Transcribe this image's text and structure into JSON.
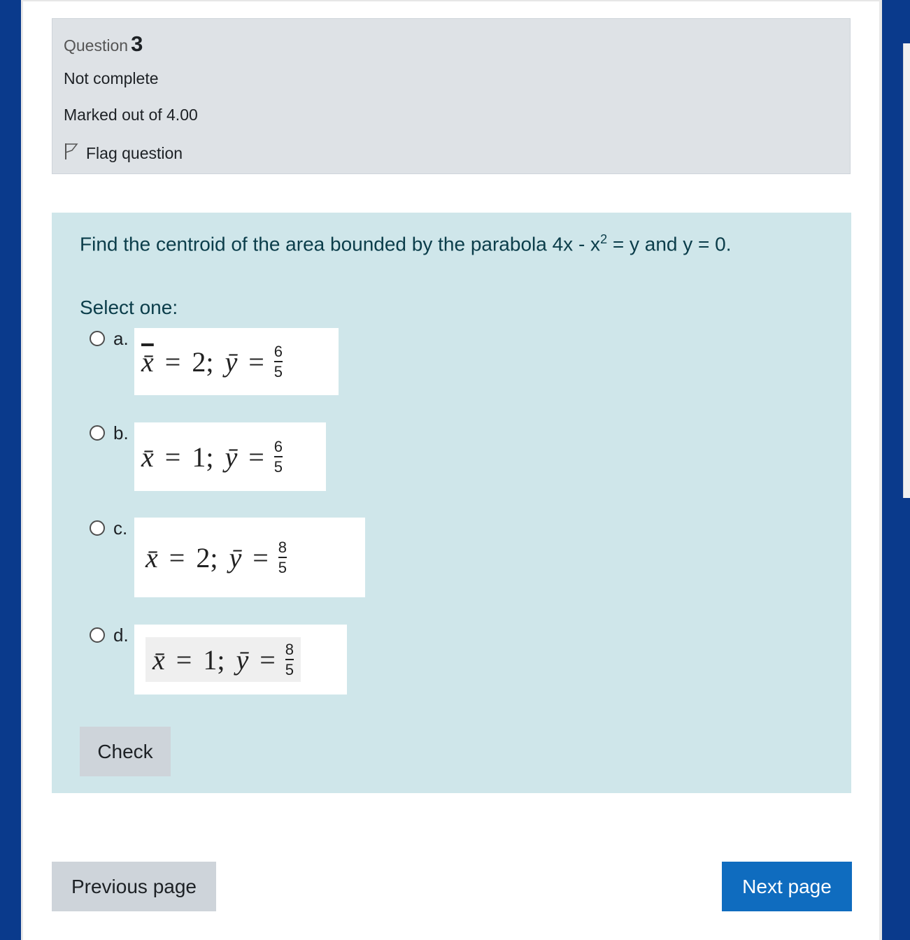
{
  "question": {
    "label": "Question",
    "number": "3",
    "state": "Not complete",
    "grade": "Marked out of 4.00",
    "flag_label": "Flag question"
  },
  "formulation": {
    "text_before_sup": "Find the centroid of the area bounded by the parabola 4x - x",
    "sup": "2",
    "text_after_sup": " = y and y = 0.",
    "prompt": "Select one:"
  },
  "options": [
    {
      "letter": "a.",
      "x_bar": "x̄",
      "x_val": "2;",
      "y_bar": "ȳ",
      "eq": "=",
      "num": "6",
      "den": "5"
    },
    {
      "letter": "b.",
      "x_bar": "x̄",
      "x_val": "1;",
      "y_bar": "ȳ",
      "eq": "=",
      "num": "6",
      "den": "5"
    },
    {
      "letter": "c.",
      "x_bar": "x̄",
      "x_val": "2;",
      "y_bar": "ȳ",
      "eq": "=",
      "num": "8",
      "den": "5"
    },
    {
      "letter": "d.",
      "x_bar": "x̄",
      "x_val": "1;",
      "y_bar": "ȳ",
      "eq": "=",
      "num": "8",
      "den": "5"
    }
  ],
  "buttons": {
    "check": "Check",
    "previous": "Previous page",
    "next": "Next page"
  },
  "colors": {
    "sidebar": "#0a3a8c",
    "info_bg": "#dee2e6",
    "formulation_bg": "#cfe6ea",
    "primary": "#0f6cbf",
    "secondary": "#ced4da"
  }
}
